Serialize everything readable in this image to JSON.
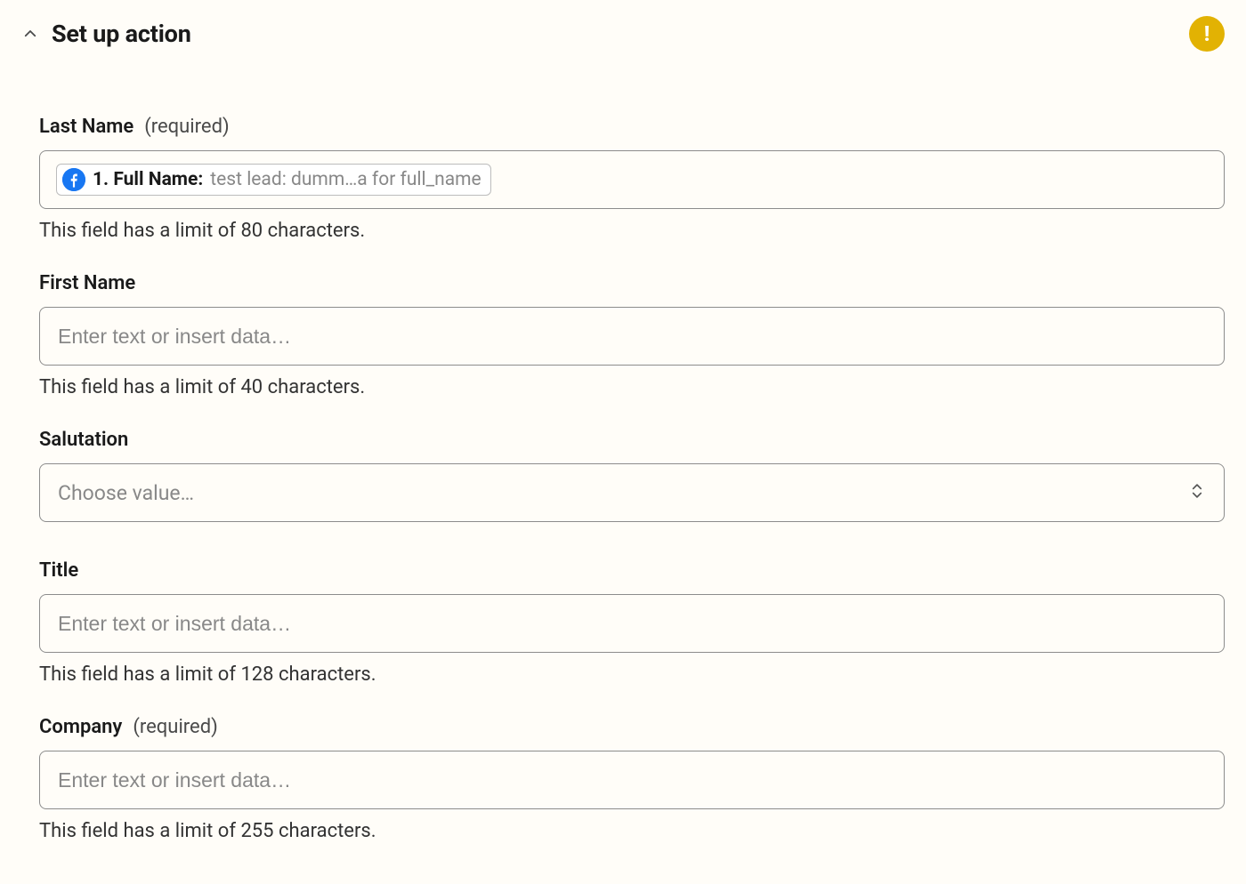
{
  "header": {
    "title": "Set up action"
  },
  "fields": {
    "last_name": {
      "label": "Last Name",
      "required_text": "(required)",
      "pill_label": "1. Full Name: ",
      "pill_value": "test lead: dumm…a for full_name",
      "help": "This field has a limit of 80 characters."
    },
    "first_name": {
      "label": "First Name",
      "placeholder": "Enter text or insert data…",
      "help": "This field has a limit of 40 characters."
    },
    "salutation": {
      "label": "Salutation",
      "placeholder": "Choose value…"
    },
    "title": {
      "label": "Title",
      "placeholder": "Enter text or insert data…",
      "help": "This field has a limit of 128 characters."
    },
    "company": {
      "label": "Company",
      "required_text": "(required)",
      "placeholder": "Enter text or insert data…",
      "help": "This field has a limit of 255 characters."
    }
  }
}
